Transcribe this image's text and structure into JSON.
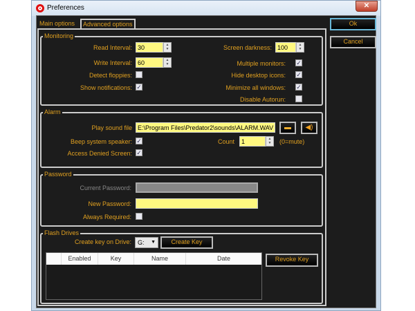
{
  "window": {
    "title": "Preferences",
    "close_glyph": "✕"
  },
  "tabs": [
    {
      "label": "Main options",
      "active": true
    },
    {
      "label": "Advanced options",
      "active": false
    }
  ],
  "buttons": {
    "ok": "Ok",
    "cancel": "Cancel"
  },
  "monitoring": {
    "title": "Monitoring",
    "read_interval": {
      "label": "Read Interval:",
      "value": "30"
    },
    "write_interval": {
      "label": "Write Interval:",
      "value": "60"
    },
    "detect_floppies": {
      "label": "Detect floppies:",
      "checked": false
    },
    "show_notifications": {
      "label": "Show notifications:",
      "checked": true
    },
    "screen_darkness": {
      "label": "Screen darkness:",
      "value": "100"
    },
    "multiple_monitors": {
      "label": "Multiple monitors:",
      "checked": true
    },
    "hide_desktop_icons": {
      "label": "Hide desktop icons:",
      "checked": true
    },
    "minimize_all_windows": {
      "label": "Minimize all windows:",
      "checked": true
    },
    "disable_autorun": {
      "label": "Disable Autorun:",
      "checked": false
    }
  },
  "alarm": {
    "title": "Alarm",
    "play_sound": {
      "label": "Play sound file",
      "value": "E:\\Program Files\\Predator2\\sounds\\ALARM.WAV"
    },
    "beep": {
      "label": "Beep system speaker:",
      "checked": true
    },
    "count": {
      "label": "Count",
      "value": "1",
      "hint": "(0=mute)"
    },
    "access_denied": {
      "label": "Access Denied Screen:",
      "checked": true
    }
  },
  "password": {
    "title": "Password",
    "current_label": "Current Password:",
    "current_value": "",
    "new_label": "New Password:",
    "new_value": "",
    "always_label": "Always Required:",
    "always_checked": false
  },
  "flash": {
    "title": "Flash Drives",
    "create_label": "Create key on Drive:",
    "drive": "G:",
    "create_button": "Create Key",
    "revoke_button": "Revoke Key",
    "columns": [
      "",
      "Enabled",
      "Key",
      "Name",
      "Date"
    ],
    "rows": []
  },
  "colors": {
    "accent": "#e0a020",
    "background": "#1c1c1c",
    "input": "#fff880"
  }
}
